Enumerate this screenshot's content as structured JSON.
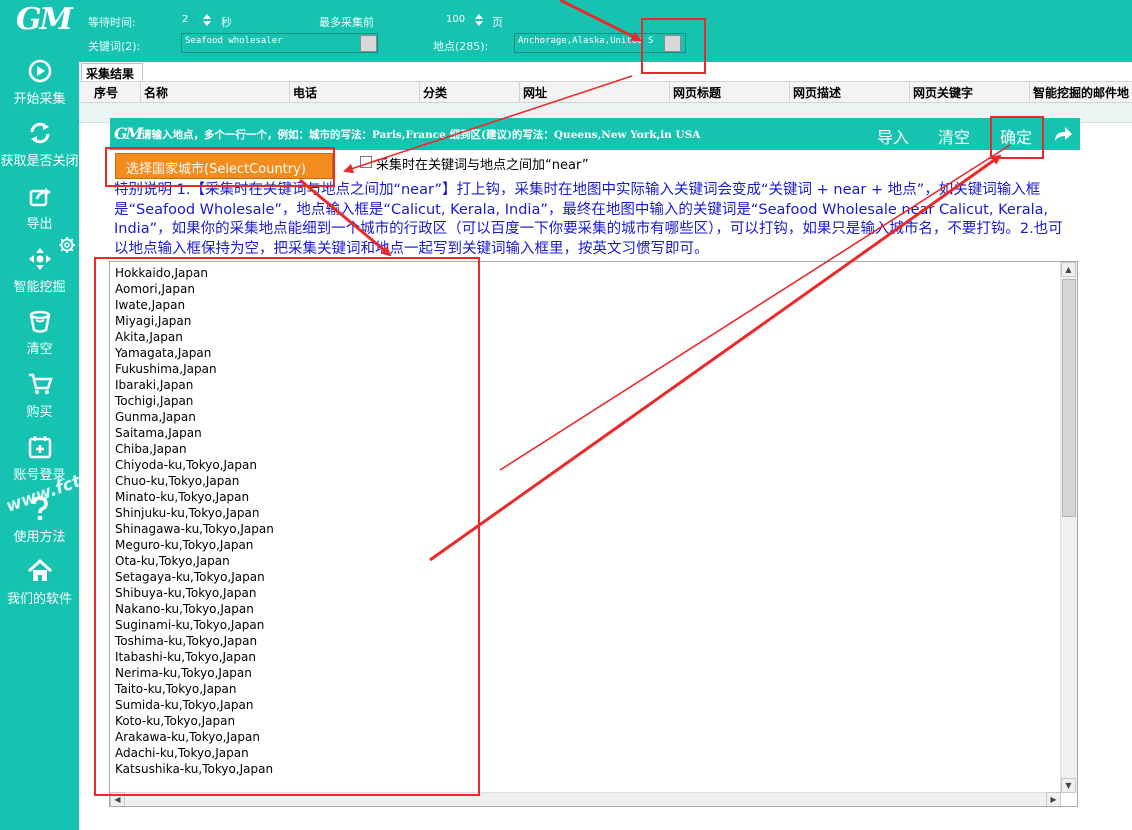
{
  "app": {
    "logo": "GM"
  },
  "sidebar": {
    "items": [
      {
        "label": "开始采集",
        "icon": "play-circle-icon"
      },
      {
        "label": "获取是否关闭",
        "icon": "refresh-icon"
      },
      {
        "label": "导出",
        "icon": "export-share-icon"
      },
      {
        "label": "智能挖掘",
        "icon": "move-arrows-icon"
      },
      {
        "label": "清空",
        "icon": "bucket-icon"
      },
      {
        "label": "购买",
        "icon": "cart-icon"
      },
      {
        "label": "账号登录",
        "icon": "calendar-plus-icon"
      },
      {
        "label": "使用方法",
        "icon": "question-icon"
      },
      {
        "label": "我们的软件",
        "icon": "home-icon"
      }
    ],
    "settings_icon": "gear-icon",
    "watermark": "www.fcti..."
  },
  "topbar": {
    "wait_label": "等待时间:",
    "wait_value": "2",
    "wait_unit": "秒",
    "max_pages_label": "最多采集前",
    "max_pages_value": "100",
    "max_pages_unit": "页",
    "keyword_label": "关键词(2):",
    "keyword_value": "Seafood wholesaler",
    "location_label": "地点(285):",
    "location_value": "Anchorage,Alaska,United S"
  },
  "results": {
    "tab_label": "采集结果",
    "columns": [
      "序号",
      "名称",
      "电话",
      "分类",
      "网址",
      "网页标题",
      "网页描述",
      "网页关键字",
      "智能挖掘的邮件地"
    ]
  },
  "dialog": {
    "logo": "GM",
    "title": "请输入地点，多个一行一个，例如：城市的写法：Paris,France 细到区(建议)的写法：Queens,New York,in USA",
    "import_label": "导入",
    "clear_label": "清空",
    "confirm_label": "确定",
    "select_country_label": "选择国家城市(SelectCountry)",
    "near_checkbox_label": "采集时在关键词与地点之间加“near”",
    "near_checked": false,
    "note": "特别说明 1.【采集时在关键词与地点之间加“near”】打上钩，采集时在地图中实际输入关键词会变成“关键词 + near + 地点”，如关键词输入框是“Seafood Wholesale”，地点输入框是“Calicut, Kerala, India”，最终在地图中输入的关键词是“Seafood Wholesale near Calicut, Kerala, India”，如果你的采集地点能细到一个城市的行政区（可以百度一下你要采集的城市有哪些区），可以打钩，如果只是输入城市名，不要打钩。2.也可以地点输入框保持为空，把采集关键词和地点一起写到关键词输入框里，按英文习惯写即可。",
    "locations": [
      "Hokkaido,Japan",
      "Aomori,Japan",
      "Iwate,Japan",
      "Miyagi,Japan",
      "Akita,Japan",
      "Yamagata,Japan",
      "Fukushima,Japan",
      "Ibaraki,Japan",
      "Tochigi,Japan",
      "Gunma,Japan",
      "Saitama,Japan",
      "Chiba,Japan",
      "Chiyoda-ku,Tokyo,Japan",
      "Chuo-ku,Tokyo,Japan",
      "Minato-ku,Tokyo,Japan",
      "Shinjuku-ku,Tokyo,Japan",
      "Shinagawa-ku,Tokyo,Japan",
      "Meguro-ku,Tokyo,Japan",
      "Ota-ku,Tokyo,Japan",
      "Setagaya-ku,Tokyo,Japan",
      "Shibuya-ku,Tokyo,Japan",
      "Nakano-ku,Tokyo,Japan",
      "Suginami-ku,Tokyo,Japan",
      "Toshima-ku,Tokyo,Japan",
      "Itabashi-ku,Tokyo,Japan",
      "Nerima-ku,Tokyo,Japan",
      "Taito-ku,Tokyo,Japan",
      "Sumida-ku,Tokyo,Japan",
      "Koto-ku,Tokyo,Japan",
      "Arakawa-ku,Tokyo,Japan",
      "Adachi-ku,Tokyo,Japan",
      "Katsushika-ku,Tokyo,Japan"
    ]
  },
  "colors": {
    "teal": "#16c3b0",
    "orange": "#f28c1e",
    "annotation_red": "#ea2a2a",
    "note_blue": "#1a1ad0"
  }
}
